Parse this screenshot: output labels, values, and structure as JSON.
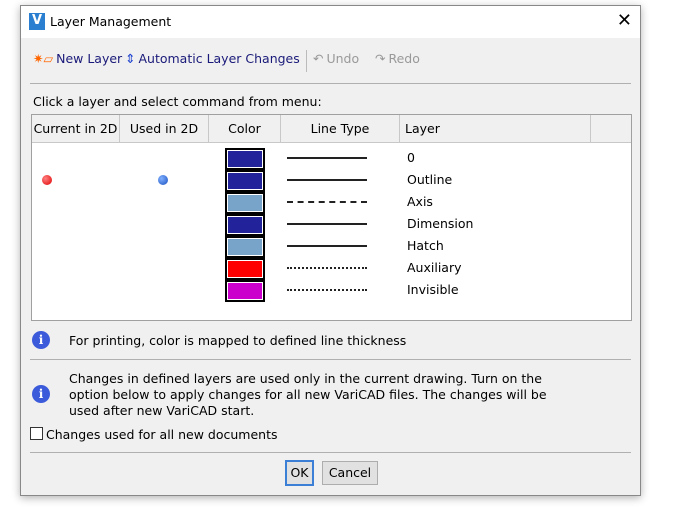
{
  "window": {
    "title": "Layer Management",
    "logo": "V"
  },
  "toolbar": {
    "new_layer": "New Layer",
    "auto_changes": "Automatic Layer Changes",
    "undo": "Undo",
    "redo": "Redo"
  },
  "instruction": "Click a layer and select command from menu:",
  "table": {
    "columns": [
      "Current in 2D",
      "Used in 2D",
      "Color",
      "Line Type",
      "Layer"
    ],
    "rows": [
      {
        "name": "0",
        "color": "#22229b",
        "line": "solid",
        "current": false,
        "used": false
      },
      {
        "name": "Outline",
        "color": "#22229b",
        "line": "solid",
        "current": true,
        "used": true
      },
      {
        "name": "Axis",
        "color": "#77a4c8",
        "line": "dash-dot",
        "current": false,
        "used": false
      },
      {
        "name": "Dimension",
        "color": "#22229b",
        "line": "solid",
        "current": false,
        "used": false
      },
      {
        "name": "Hatch",
        "color": "#77a4c8",
        "line": "solid",
        "current": false,
        "used": false
      },
      {
        "name": "Auxiliary",
        "color": "#ff0000",
        "line": "dotted",
        "current": false,
        "used": false
      },
      {
        "name": "Invisible",
        "color": "#cc00cc",
        "line": "dotted",
        "current": false,
        "used": false
      }
    ]
  },
  "info1": "For printing, color is mapped to defined line thickness",
  "info2": "Changes in defined layers are used only in the current drawing. Turn on the option below to apply changes for all new VariCAD files. The changes will be used after new VariCAD start.",
  "checkbox": {
    "label": "Changes used for all new documents",
    "checked": false
  },
  "buttons": {
    "ok": "OK",
    "cancel": "Cancel"
  }
}
